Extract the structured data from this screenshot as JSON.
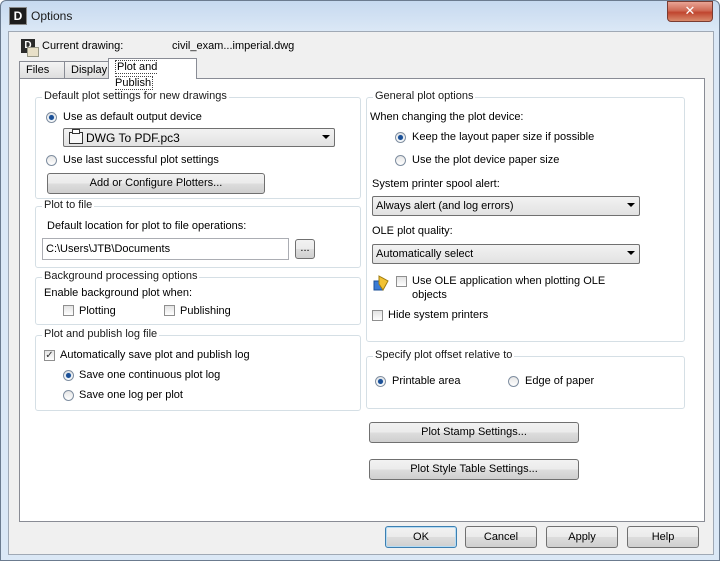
{
  "window": {
    "title": "Options",
    "app_icon": "D"
  },
  "current_drawing": {
    "label": "Current drawing:",
    "value": "civil_exam...imperial.dwg"
  },
  "tabs": [
    {
      "label": "Files"
    },
    {
      "label": "Display"
    },
    {
      "label": "Plot and Publish",
      "active": true
    }
  ],
  "default_plot": {
    "legend": "Default plot settings for new drawings",
    "use_default_label": "Use as default output device",
    "device_value": "DWG To PDF.pc3",
    "use_last_label": "Use last successful plot settings",
    "add_plotters_label": "Add or Configure Plotters..."
  },
  "plot_to_file": {
    "legend": "Plot to file",
    "default_location_label": "Default location for plot to file operations:",
    "path_value": "C:\\Users\\JTB\\Documents",
    "browse_label": "..."
  },
  "background": {
    "legend": "Background processing options",
    "enable_label": "Enable background plot when:",
    "plotting_label": "Plotting",
    "publishing_label": "Publishing"
  },
  "log": {
    "legend": "Plot and publish log file",
    "auto_save_label": "Automatically save plot and publish log",
    "continuous_label": "Save one continuous plot log",
    "per_plot_label": "Save one log per plot"
  },
  "general": {
    "legend": "General plot options",
    "changing_label": "When changing the plot device:",
    "keep_layout_label": "Keep the layout paper size if possible",
    "use_device_label": "Use the plot device paper size",
    "spool_label": "System printer spool alert:",
    "spool_value": "Always alert (and log errors)",
    "ole_quality_label": "OLE plot quality:",
    "ole_quality_value": "Automatically select",
    "use_ole_label_1": "Use OLE application when plotting OLE",
    "use_ole_label_2": "objects",
    "hide_printers_label": "Hide system printers"
  },
  "offset": {
    "legend": "Specify plot offset relative to",
    "printable_label": "Printable area",
    "edge_label": "Edge of paper"
  },
  "buttons": {
    "plot_stamp": "Plot Stamp Settings...",
    "plot_style": "Plot Style Table Settings...",
    "ok": "OK",
    "cancel": "Cancel",
    "apply": "Apply",
    "help": "Help",
    "close": "✕"
  }
}
